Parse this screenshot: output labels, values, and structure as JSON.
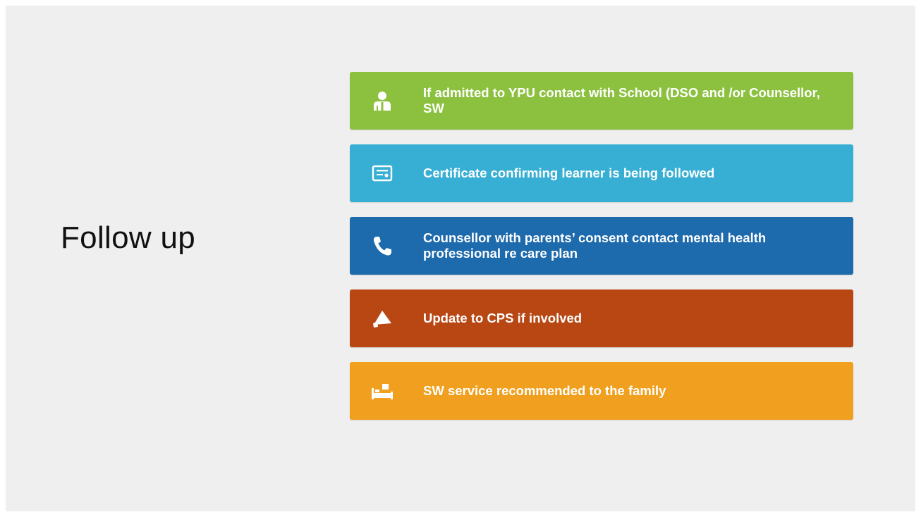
{
  "slide": {
    "title": "Follow up"
  },
  "items": [
    {
      "icon": "person-icon",
      "color": "#8cc13f",
      "text": "If admitted to YPU contact with School (DSO and /or Counsellor, SW"
    },
    {
      "icon": "certificate-icon",
      "color": "#37afd4",
      "text": "Certificate confirming learner is being followed"
    },
    {
      "icon": "phone-icon",
      "color": "#1d6aac",
      "text": "Counsellor with parents’ consent contact mental health professional re care plan"
    },
    {
      "icon": "megaphone-icon",
      "color": "#b84714",
      "text": "Update to CPS if involved"
    },
    {
      "icon": "bed-icon",
      "color": "#f0a01e",
      "text": "SW service recommended to the family"
    }
  ]
}
